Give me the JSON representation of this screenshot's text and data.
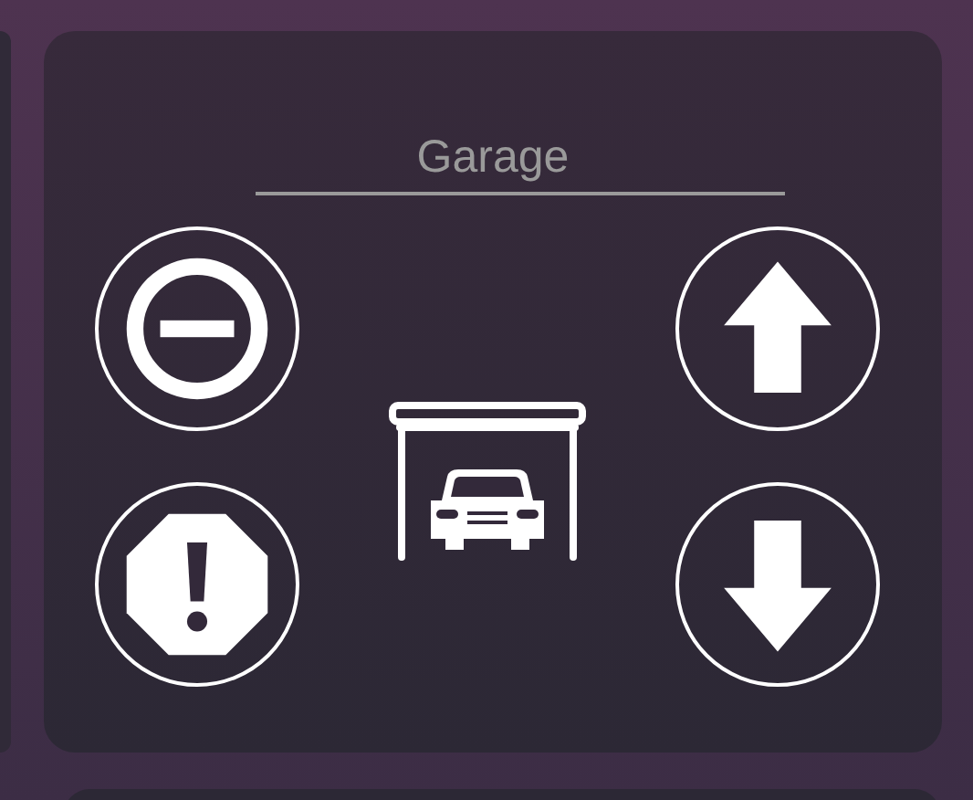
{
  "card": {
    "title": "Garage",
    "left_buttons": [
      {
        "kind": "stop"
      },
      {
        "kind": "alarm"
      }
    ],
    "right_buttons": [
      {
        "kind": "up"
      },
      {
        "kind": "down"
      }
    ]
  }
}
